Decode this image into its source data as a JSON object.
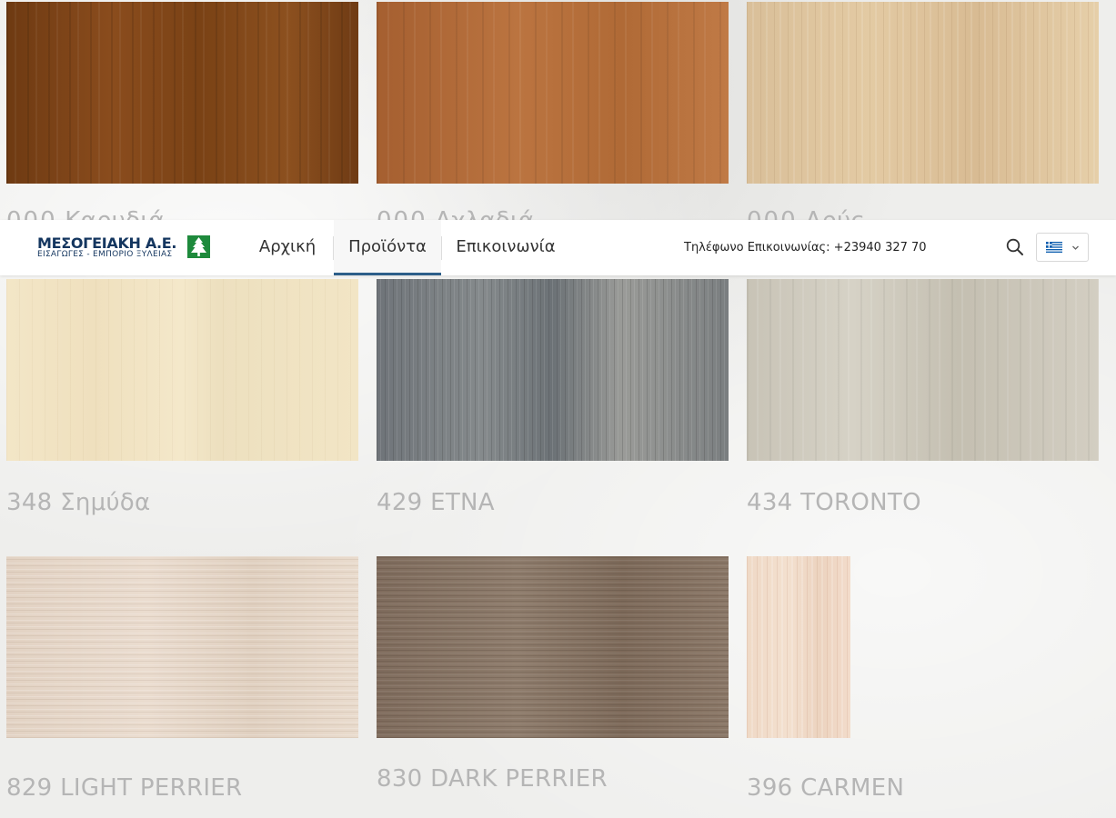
{
  "header": {
    "logo": {
      "name": "ΜΕΣΟΓΕΙΑΚΗ Α.Ε.",
      "tagline": "ΕΙΣΑΓΩΓΕΣ - ΕΜΠΟΡΙΟ ΞΥΛΕΙΑΣ",
      "icon": "pine-tree-icon",
      "brand_color": "#14365f",
      "accent_color": "#1e8a3c"
    },
    "nav": [
      {
        "label": "Αρχική",
        "active": false
      },
      {
        "label": "Προϊόντα",
        "active": true
      },
      {
        "label": "Επικοινωνία",
        "active": false
      }
    ],
    "phone": "Τηλέφωνο Επικοινωνίας: +23940 327 70",
    "search_icon": "search-icon",
    "language": {
      "flag": "greek-flag-icon",
      "chevron": "chevron-down-icon"
    }
  },
  "products": [
    {
      "label": "Καρυδιά",
      "partial": true
    },
    {
      "label": "Αχλαδιά",
      "partial": true
    },
    {
      "label": "Δρύς",
      "partial": true
    },
    {
      "label": "348 Σημύδα"
    },
    {
      "label": "429 ETNA"
    },
    {
      "label": "434 TORONTO"
    },
    {
      "label": "829 LIGHT PERRIER"
    },
    {
      "label": "830 DARK PERRIER"
    },
    {
      "label": "396 CARMEN"
    }
  ],
  "colors": {
    "caption": "#b5b5b5",
    "nav_active_underline": "#2d5f8a"
  }
}
